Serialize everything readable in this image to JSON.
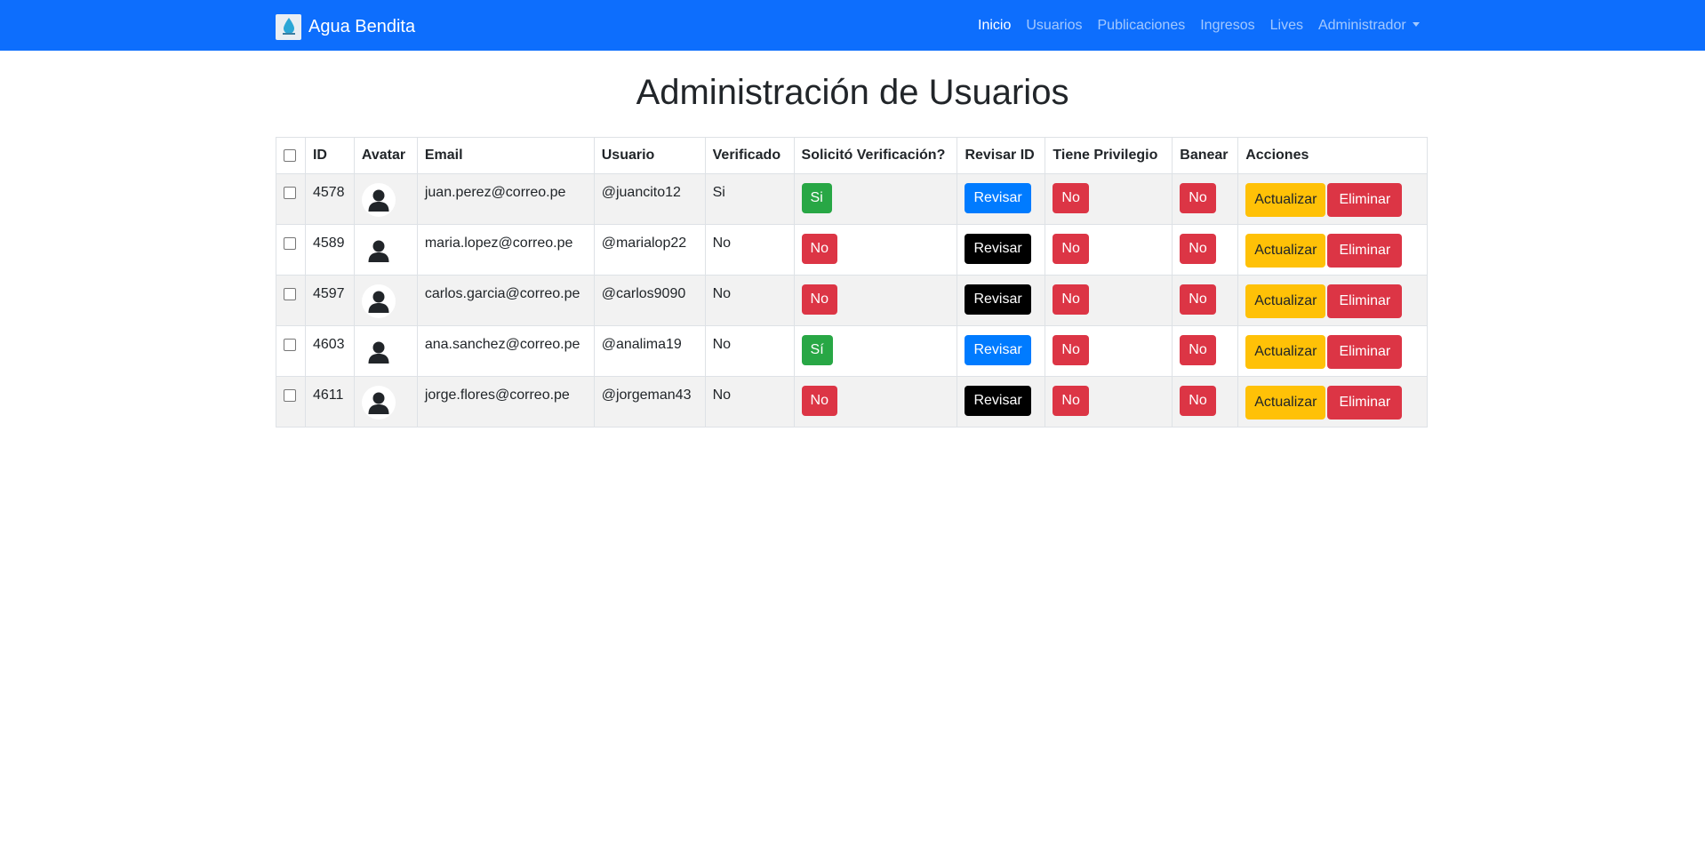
{
  "navbar": {
    "brand": "Agua Bendita",
    "links": [
      "Inicio",
      "Usuarios",
      "Publicaciones",
      "Ingresos",
      "Lives"
    ],
    "dropdown": "Administrador"
  },
  "page": {
    "title": "Administración de Usuarios"
  },
  "table": {
    "headers": [
      "ID",
      "Avatar",
      "Email",
      "Usuario",
      "Verificado",
      "Solicitó Verificación?",
      "Revisar ID",
      "Tiene Privilegio",
      "Banear",
      "Acciones"
    ],
    "rows": [
      {
        "id": "4578",
        "email": "juan.perez@correo.pe",
        "usuario": "@juancito12",
        "verificado": "Si",
        "solicito": "Si",
        "revisar": "Revisar",
        "privilegio": "No",
        "banear": "No",
        "actualizar": "Actualizar",
        "eliminar": "Eliminar"
      },
      {
        "id": "4589",
        "email": "maria.lopez@correo.pe",
        "usuario": "@marialop22",
        "verificado": "No",
        "solicito": "No",
        "revisar": "Revisar",
        "privilegio": "No",
        "banear": "No",
        "actualizar": "Actualizar",
        "eliminar": "Eliminar"
      },
      {
        "id": "4597",
        "email": "carlos.garcia@correo.pe",
        "usuario": "@carlos9090",
        "verificado": "No",
        "solicito": "No",
        "revisar": "Revisar",
        "privilegio": "No",
        "banear": "No",
        "actualizar": "Actualizar",
        "eliminar": "Eliminar"
      },
      {
        "id": "4603",
        "email": "ana.sanchez@correo.pe",
        "usuario": "@analima19",
        "verificado": "No",
        "solicito": "Sí",
        "revisar": "Revisar",
        "privilegio": "No",
        "banear": "No",
        "actualizar": "Actualizar",
        "eliminar": "Eliminar"
      },
      {
        "id": "4611",
        "email": "jorge.flores@correo.pe",
        "usuario": "@jorgeman43",
        "verificado": "No",
        "solicito": "No",
        "revisar": "Revisar",
        "privilegio": "No",
        "banear": "No",
        "actualizar": "Actualizar",
        "eliminar": "Eliminar"
      }
    ]
  },
  "colors": {
    "navbar": "#0d6efd",
    "success": "#28a745",
    "danger": "#dc3545",
    "primary": "#007bff",
    "dark": "#000000",
    "warning": "#ffc107"
  }
}
